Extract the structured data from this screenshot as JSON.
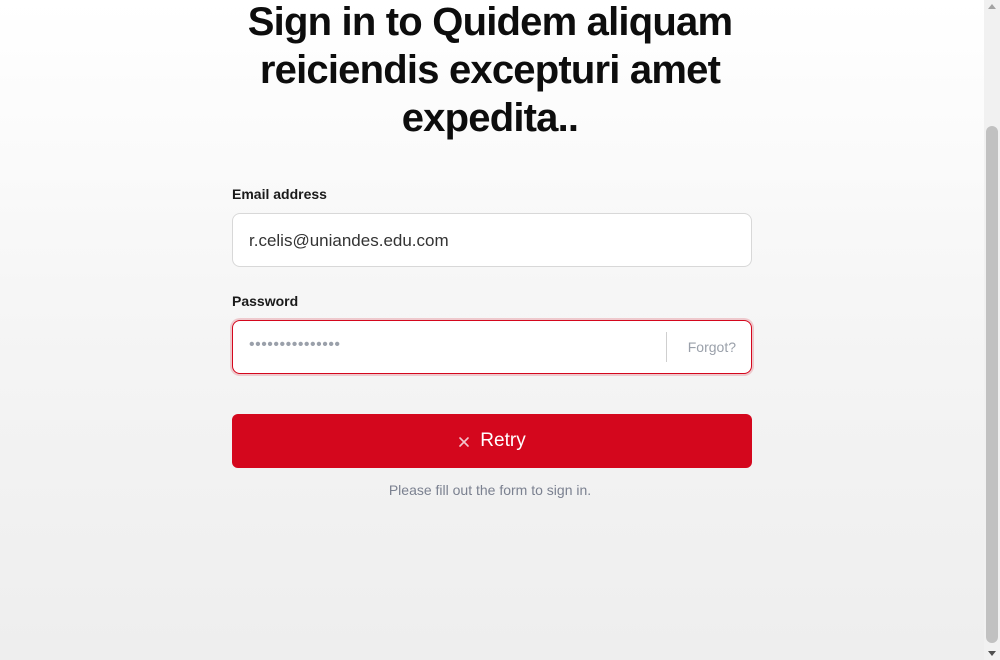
{
  "page": {
    "title": "Sign in to Quidem aliquam reiciendis excepturi amet expedita.."
  },
  "form": {
    "email": {
      "label": "Email address",
      "value": "r.celis@uniandes.edu.com"
    },
    "password": {
      "label": "Password",
      "masked_value": "•••••••••••••••",
      "forgot_label": "Forgot?"
    },
    "submit": {
      "label": "Retry",
      "icon": "close-icon"
    },
    "helper_text": "Please fill out the form to sign in."
  },
  "colors": {
    "accent": "#d4071d",
    "muted_text": "#7b8190",
    "placeholder": "#9aa0aa"
  }
}
